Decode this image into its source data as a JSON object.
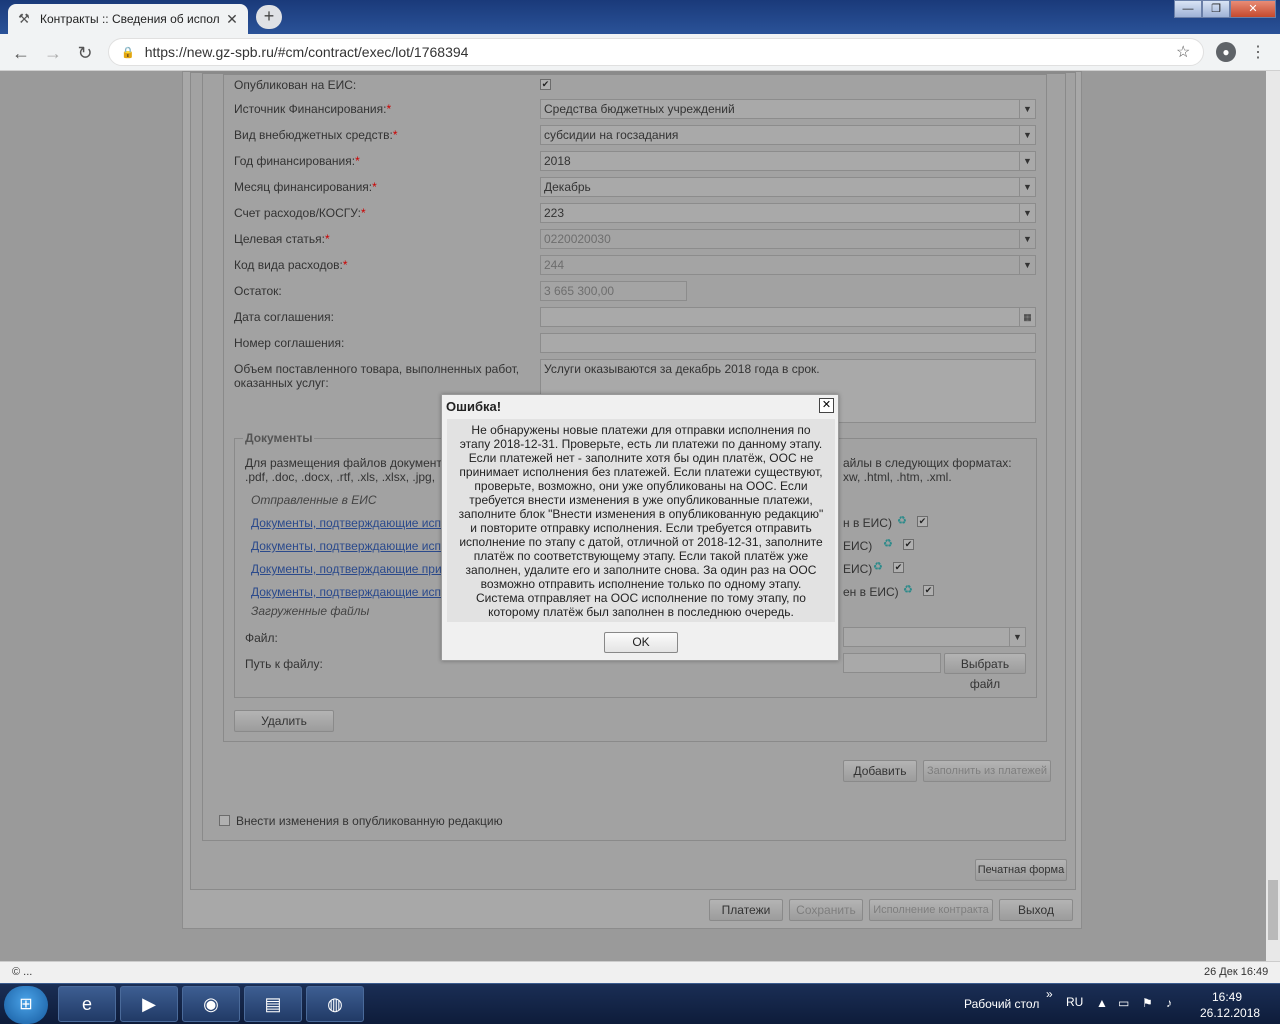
{
  "browser": {
    "tab_title": "Контракты :: Сведения об испол",
    "new_tab": "+",
    "url": "https://new.gz-spb.ru/#cm/contract/exec/lot/1768394",
    "window_buttons": {
      "minimize": "—",
      "maximize": "❐",
      "close": "✕"
    }
  },
  "form": {
    "published_label": "Опубликован на ЕИС:",
    "fields": [
      {
        "label": "Источник Финансирования:",
        "value": "Средства бюджетных учреждений"
      },
      {
        "label": "Вид внебюджетных средств:",
        "value": "субсидии на госзадания"
      },
      {
        "label": "Год финансирования:",
        "value": "2018"
      },
      {
        "label": "Месяц финансирования:",
        "value": "Декабрь"
      },
      {
        "label": "Счет расходов/КОСГУ:",
        "value": "223"
      },
      {
        "label": "Целевая статья:",
        "value": "0220020030"
      },
      {
        "label": "Код вида расходов:",
        "value": "244"
      }
    ],
    "required_mark": "*",
    "remainder_label": "Остаток:",
    "remainder_value": "3 665 300,00",
    "agreement_date_label": "Дата соглашения:",
    "agreement_number_label": "Номер соглашения:",
    "volume_label": "Объем поставленного товара, выполненных работ, оказанных услуг:",
    "volume_value": "Услуги оказываются за декабрь 2018 года в срок."
  },
  "documents": {
    "legend": "Документы",
    "hint_left": "Для размещения файлов документа",
    "hint_left2": ".pdf, .doc, .docx, .rtf, .xls, .xlsx, .jpg,",
    "hint_right": "айлы в следующих форматах:",
    "hint_right2": "xw, .html, .htm, .xml.",
    "sent_label": "Отправленные в ЕИС",
    "links": [
      {
        "text": "Документы, подтверждающие испо",
        "tail": "н в ЕИС)"
      },
      {
        "text": "Документы, подтверждающие испо",
        "tail": "ЕИС)"
      },
      {
        "text": "Документы, подтверждающие при",
        "tail": "ЕИС)"
      },
      {
        "text": "Документы, подтверждающие испо",
        "tail": "ен в ЕИС)"
      }
    ],
    "loaded_label": "Загруженные файлы",
    "file_label": "Файл:",
    "path_label": "Путь к файлу:",
    "choose_file": "Выбрать файл",
    "delete_btn": "Удалить"
  },
  "actions": {
    "add": "Добавить",
    "fill_from_payments": "Заполнить из платежей",
    "amend_label": "Внести изменения в опубликованную редакцию",
    "print_form": "Печатная форма",
    "payments": "Платежи",
    "save": "Сохранить",
    "contract_execution": "Исполнение контракта",
    "exit": "Выход"
  },
  "dialog": {
    "title": "Ошибка!",
    "close": "✕",
    "message": "Не обнаружены новые платежи для отправки исполнения по этапу 2018-12-31. Проверьте, есть ли платежи по данному этапу. Если платежей нет - заполните хотя бы один платёж, ООС не принимает исполнения без платежей. Если платежи существуют, проверьте, возможно, они уже опубликованы на ООС. Если требуется внести изменения в уже опубликованные платежи, заполните блок \"Внести изменения в опубликованную редакцию\" и повторите отправку исполнения. Если требуется отправить исполнение по этапу с датой, отличной от 2018-12-31, заполните платёж по соответствующему этапу. Если такой платёж уже заполнен, удалите его и заполните снова. За один раз на ООС возможно отправить исполнение только по одному этапу. Система отправляет на ООС исполнение по тому этапу, по которому платёж был заполнен в последнюю очередь.",
    "ok": "OK"
  },
  "statusbar": {
    "left": "© ...",
    "right": "26 Дек 16:49"
  },
  "taskbar": {
    "desktop": "Рабочий стол",
    "chevron": "»",
    "lang": "RU",
    "time": "16:49",
    "date": "26.12.2018"
  }
}
